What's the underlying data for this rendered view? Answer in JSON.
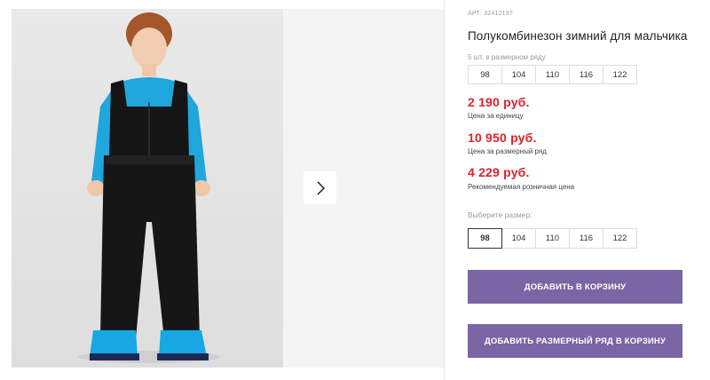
{
  "product": {
    "article": "АРТ: 32412197",
    "title": "Полукомбинезон зимний для мальчика"
  },
  "size_row": {
    "label": "5 шт. в размерном ряду",
    "sizes": [
      "98",
      "104",
      "110",
      "116",
      "122"
    ]
  },
  "prices": [
    {
      "amount": "2 190 руб.",
      "note": "Цена за единицу"
    },
    {
      "amount": "10 950 руб.",
      "note": "Цена за размерный ряд"
    },
    {
      "amount": "4 229 руб.",
      "note": "Рекомендуемая розничная цена"
    }
  ],
  "size_picker": {
    "label": "Выберите размер:",
    "sizes": [
      "98",
      "104",
      "110",
      "116",
      "122"
    ],
    "selected": "98"
  },
  "buttons": {
    "add_to_cart": "ДОБАВИТЬ В КОРЗИНУ",
    "add_row_to_cart": "ДОБАВИТЬ РАЗМЕРНЫЙ РЯД В КОРЗИНУ"
  },
  "gallery": {
    "next_icon": "chevron-right-icon"
  },
  "colors": {
    "price": "#e0202a",
    "button": "#7a65a5"
  }
}
